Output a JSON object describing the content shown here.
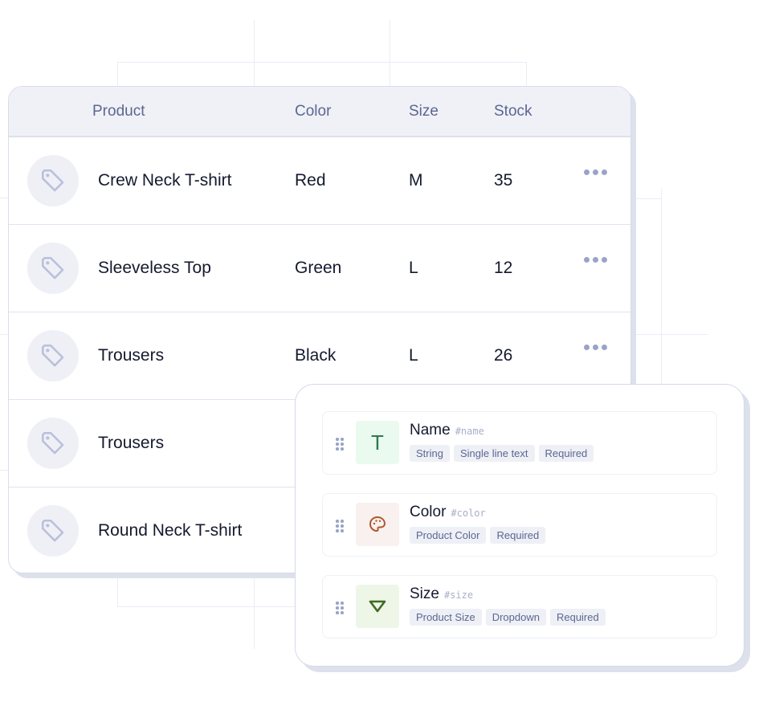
{
  "table": {
    "columns": {
      "product": "Product",
      "color": "Color",
      "size": "Size",
      "stock": "Stock"
    },
    "rows": [
      {
        "product": "Crew Neck T-shirt",
        "color": "Red",
        "size": "M",
        "stock": "35",
        "icon": "tag-icon",
        "has_menu": true
      },
      {
        "product": "Sleeveless Top",
        "color": "Green",
        "size": "L",
        "stock": "12",
        "icon": "tag-icon",
        "has_menu": true
      },
      {
        "product": "Trousers",
        "color": "Black",
        "size": "L",
        "stock": "26",
        "icon": "tag-icon",
        "has_menu": true
      },
      {
        "product": "Trousers",
        "color": "",
        "size": "",
        "stock": "",
        "icon": "tag-icon",
        "has_menu": false
      },
      {
        "product": "Round Neck T-shirt",
        "color": "",
        "size": "",
        "stock": "",
        "icon": "tag-icon",
        "has_menu": false
      }
    ]
  },
  "fields": [
    {
      "name": "Name",
      "key": "#name",
      "icon": "text-type-icon",
      "icon_glyph": "T",
      "icon_bg": "#eafaef",
      "icon_color": "#2e7a4f",
      "tags": [
        "String",
        "Single line text",
        "Required"
      ]
    },
    {
      "name": "Color",
      "key": "#color",
      "icon": "palette-icon",
      "icon_bg": "#f9f1ef",
      "icon_color": "#b0582a",
      "tags": [
        "Product Color",
        "Required"
      ]
    },
    {
      "name": "Size",
      "key": "#size",
      "icon": "dropdown-triangle-icon",
      "icon_bg": "#eef6e8",
      "icon_color": "#3f6b22",
      "tags": [
        "Product Size",
        "Dropdown",
        "Required"
      ]
    }
  ]
}
